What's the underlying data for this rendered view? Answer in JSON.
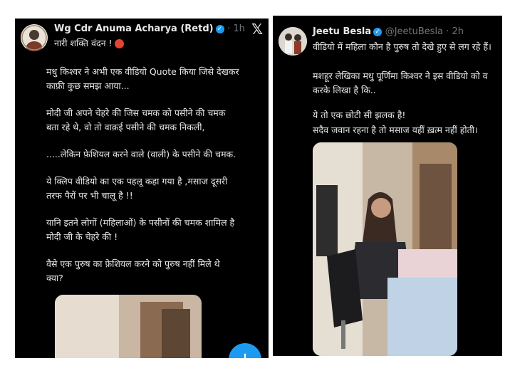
{
  "left_post": {
    "author_name": "Wg Cdr Anuma Acharya (Retd)",
    "time": "· 1h",
    "close_glyph": "𝕏",
    "lines": [
      "नारी शक्ति वंदन !",
      "मधु किश्वर ने अभी एक वीडियो Quote किया जिसे देखकर",
      "काफ़ी कुछ समझ आया...",
      "मोदी जी अपने चेहरे की जिस चमक को पसीने की चमक",
      "बता रहे थे, वो तो वाक़ई पसीने की चमक निकली,",
      ".....लेकिन फ़ेशियल करने वाले (वाली) के पसीने की चमक.",
      "ये क्लिप वीडियो का एक पहलू कहा गया है ,मसाज दूसरी",
      "तरफ पैरों पर भी चालू है !!",
      "यानि इतने लोगों (महिलाओं) के पसीनों की चमक शामिल है",
      "मोदी जी के चेहरे की !",
      "वैसे एक पुरुष का फ़ेशियल करने को पुरुष नहीं मिले थे",
      "क्या?"
    ],
    "fab_label": "+",
    "icons": {
      "verified": "verified-badge-icon",
      "emoji": "angry-face-emoji-icon",
      "fab": "compose-plus-icon",
      "brand": "x-logo-icon"
    }
  },
  "right_post": {
    "author_name": "Jeetu Besla",
    "handle": "@JeetuBesla · 2h",
    "lines": [
      "वीडियो में महिला कौन है पुरुष तो देखे हुए से लग रहे हैं।",
      "मशहूर लेखिका मधु पूर्णिमा किश्वर ने इस वीडियो को व",
      "करके लिखा है कि..",
      "ये तो एक छोटी सी झलक है!",
      "सदैव जवान रहना है तो  मसाज यहीं ख़त्म नहीं होती।"
    ],
    "icons": {
      "verified": "verified-badge-icon",
      "video": "video-thumbnail"
    }
  },
  "colors": {
    "background": "#000000",
    "text": "#e7e9ea",
    "muted": "#71767b",
    "accent": "#1d9bf0"
  }
}
